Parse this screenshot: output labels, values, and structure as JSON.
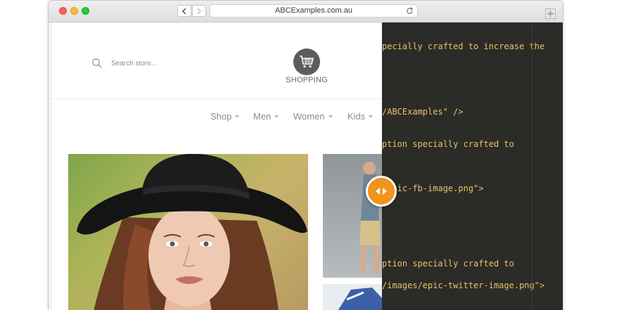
{
  "browser": {
    "url": "ABCExamples.com.au",
    "back_icon": "chevron-left-icon",
    "forward_icon": "chevron-right-icon",
    "reload_icon": "reload-icon"
  },
  "store": {
    "search_placeholder": "Search store...",
    "logo_text": "SHOPPING",
    "logo_icon": "shopping-cart-icon",
    "nav": [
      {
        "label": "Shop"
      },
      {
        "label": "Men"
      },
      {
        "label": "Women"
      },
      {
        "label": "Kids"
      }
    ]
  },
  "code": {
    "lines": [
      "pecially crafted to increase the",
      "/ABCExamples\" />",
      "ption specially crafted to",
      "/epic-fb-image.png\">",
      "ption specially crafted to",
      "/images/epic-twitter-image.png\">"
    ],
    "text_color": "#e8c267",
    "background": "#2b2b28"
  },
  "compare_handle": {
    "color": "#f0941c",
    "icon": "left-right-arrows-icon"
  }
}
